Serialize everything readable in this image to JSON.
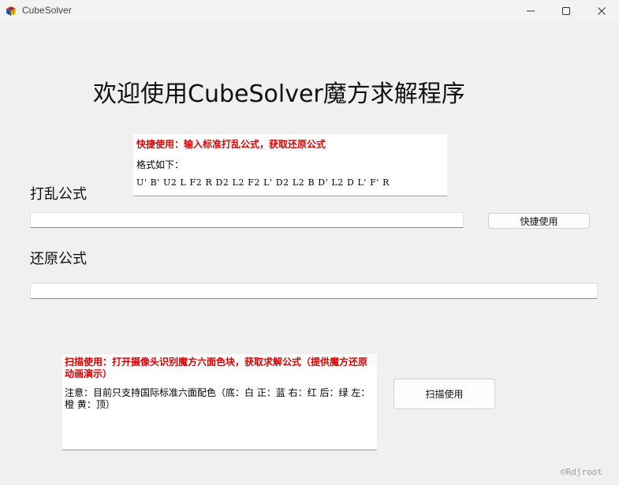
{
  "window": {
    "title": "CubeSolver",
    "controls": [
      "minimize-icon",
      "maximize-icon",
      "close-icon"
    ]
  },
  "main": {
    "heading": "欢迎使用CubeSolver魔方求解程序",
    "quick_info": {
      "title": "快捷使用：输入标准打乱公式，获取还原公式",
      "format_label": "格式如下：",
      "example": "U' B' U2 L F2 R D2 L2 F2 L' D2 L2 B D' L2 D L' F' R"
    },
    "scramble_label": "打乱公式",
    "scramble_value": "",
    "quick_button": "快捷使用",
    "restore_label": "还原公式",
    "restore_value": "",
    "scan_info": {
      "title": "扫描使用：打开摄像头识别魔方六面色块，获取求解公式（提供魔方还原动画演示）",
      "note": "注意：目前只支持国际标准六面配色（底：白 正：蓝 右：红 后：绿 左：橙 黄：顶）"
    },
    "scan_button": "扫描使用"
  },
  "footer": {
    "credit": "©Rdjroot"
  }
}
